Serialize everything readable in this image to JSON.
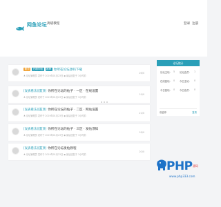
{
  "header": {
    "logo_text": "网鱼论坛",
    "nav_link": "高级教程",
    "login": "登录",
    "register": "注册"
  },
  "posts": [
    {
      "badge1": "置顶",
      "badge2": "已精华贴",
      "badge3": "推荐",
      "title": "你所在论坛源码下载",
      "meta": "♣ 论坛管理员 发布于 2019年01月23日  ◉ 最后回复于 3小时前",
      "count": "26/0"
    },
    {
      "tag": "[发表看法][置顶]",
      "title": "你所在论坛的帖子 · 一区 · 在线设置",
      "meta": "♣ 论坛管理员 发布于 2019年01月23日  ◉ 最后回复于 3小时前",
      "count": "19/0"
    },
    {
      "tag": "[发表看法][置顶]",
      "title": "你所在论坛的帖子 · 二区 · 网站设置",
      "meta": "♣ 论坛管理员 发布于 2019年01月23日  ◉ 最后回复于 3小时前",
      "count": "21/0"
    },
    {
      "tag": "[发表看法][置顶]",
      "title": "你所在论坛的帖子 · 三区 · 发帖须知",
      "meta": "♣ 论坛管理员 发布于 2019年01月23日  ◉ 最后回复于 3小时前",
      "count": "18/0"
    },
    {
      "tag": "[发表看法][置顶]",
      "title": "你所在论坛发帖教程",
      "meta": "♣ 论坛管理员 发布于 2019年01月23日  ◉ 最后回复于 3小时前",
      "count": "20/0"
    }
  ],
  "sidebar": {
    "title": "论坛统计",
    "stats": [
      {
        "label": "论坛主帖:",
        "value": "5"
      },
      {
        "label": "论坛会员:",
        "value": "1"
      },
      {
        "label": "在线回帖:",
        "value": "0"
      },
      {
        "label": "今日主帖:",
        "value": "0"
      },
      {
        "label": "今日回帖:",
        "value": "0"
      },
      {
        "label": "今日会员:",
        "value": "0"
      }
    ],
    "footer_text": "欢迎你",
    "footer_link": "登录"
  },
  "watermark": {
    "brand": "PHP",
    "tag": "源码",
    "url": "www.php333.com"
  },
  "colors": {
    "accent": "#2a9fb8",
    "badge_orange": "#f0a030",
    "watermark_blue": "#1e73c8"
  }
}
